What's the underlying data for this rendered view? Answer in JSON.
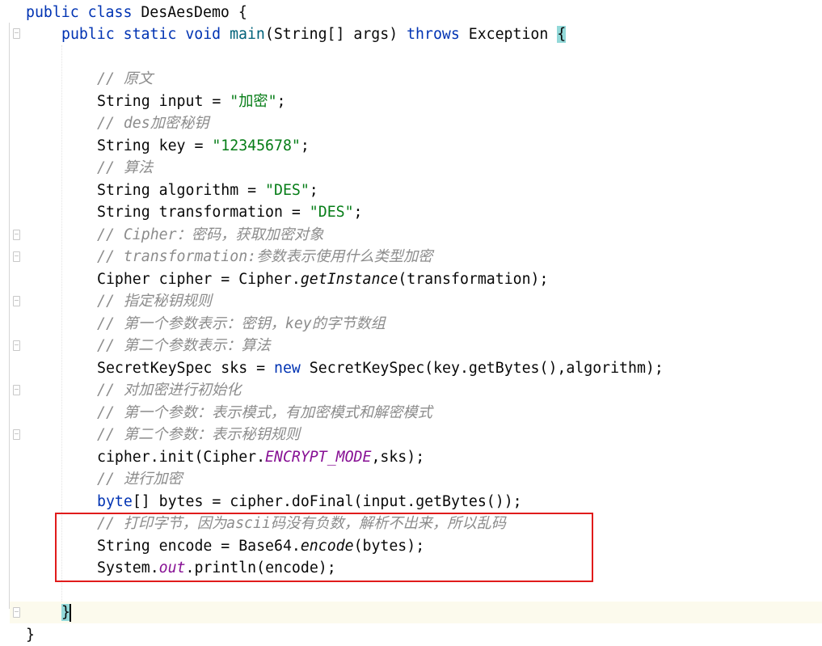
{
  "code": {
    "l1": {
      "kw1": "public",
      "kw2": "class",
      "name": "DesAesDemo",
      "brace": "{"
    },
    "l2": {
      "kw1": "public",
      "kw2": "static",
      "kw3": "void",
      "method": "main",
      "params": "(String[] args)",
      "kw4": "throws",
      "exc": "Exception",
      "brace": "{"
    },
    "l4": "// 原文",
    "l5": {
      "pre": "String input = ",
      "str": "\"加密\"",
      "post": ";"
    },
    "l6": "// des加密秘钥",
    "l7": {
      "pre": "String key = ",
      "str": "\"12345678\"",
      "post": ";"
    },
    "l8": "// 算法",
    "l9": {
      "pre": "String algorithm = ",
      "str": "\"DES\"",
      "post": ";"
    },
    "l10": {
      "pre": "String transformation = ",
      "str": "\"DES\"",
      "post": ";"
    },
    "l11": "// Cipher：密码，获取加密对象",
    "l12": "// transformation:参数表示使用什么类型加密",
    "l13": {
      "pre": "Cipher cipher = Cipher.",
      "method": "getInstance",
      "post": "(transformation);"
    },
    "l14": "// 指定秘钥规则",
    "l15": "// 第一个参数表示：密钥，key的字节数组",
    "l16": "// 第二个参数表示：算法",
    "l17": {
      "pre": "SecretKeySpec sks = ",
      "kw": "new",
      "post": " SecretKeySpec(key.getBytes(),algorithm);"
    },
    "l18": "// 对加密进行初始化",
    "l19": "// 第一个参数：表示模式，有加密模式和解密模式",
    "l20": "// 第二个参数：表示秘钥规则",
    "l21": {
      "pre": "cipher.init(Cipher.",
      "const": "ENCRYPT_MODE",
      "post": ",sks);"
    },
    "l22": "// 进行加密",
    "l23": {
      "kw": "byte",
      "post": "[] bytes = cipher.doFinal(input.getBytes());"
    },
    "l24": "// 打印字节，因为ascii码没有负数，解析不出来，所以乱码",
    "l25": {
      "pre": "String encode = Base64.",
      "method": "encode",
      "post": "(bytes);"
    },
    "l26": {
      "pre": "System.",
      "field": "out",
      "post": ".println(encode);"
    },
    "l28": "}",
    "l29": "}"
  }
}
